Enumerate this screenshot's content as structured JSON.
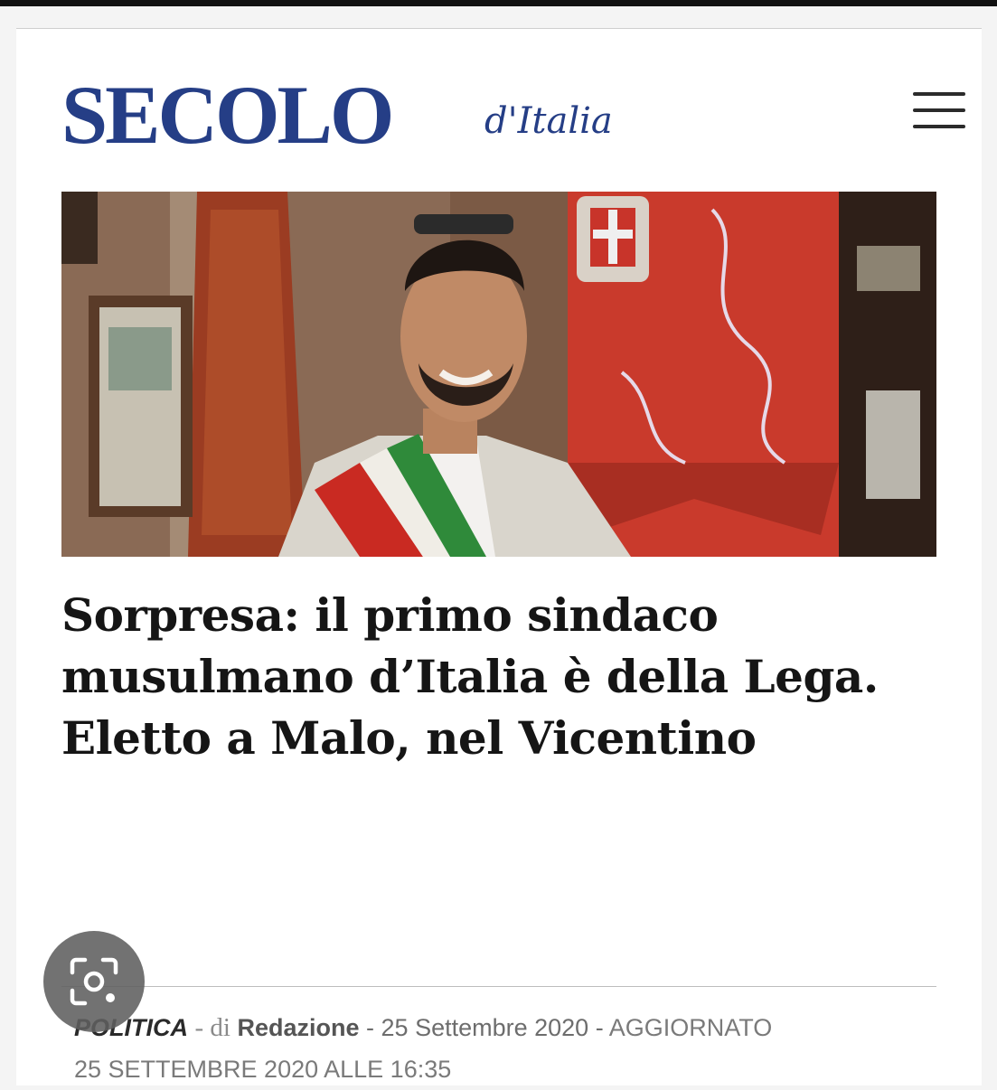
{
  "brand": {
    "name": "SECOLO",
    "script": "d'Italia",
    "color": "#253e86"
  },
  "header": {
    "menu_icon": "hamburger-menu-icon"
  },
  "article": {
    "headline": "Sorpresa: il primo sindaco musulmano d’Italia è della Lega. Eletto a Malo, nel Vicentino",
    "category": "POLITICA",
    "byline_prefix": "- di",
    "author": "Redazione",
    "date": "- 25 Settembre 2020 -",
    "updated_label": "AGGIORNATO",
    "updated_datetime": "25 SETTEMBRE 2020 ALLE 16:35"
  },
  "overlay": {
    "lens_icon": "visual-search-lens-icon"
  }
}
